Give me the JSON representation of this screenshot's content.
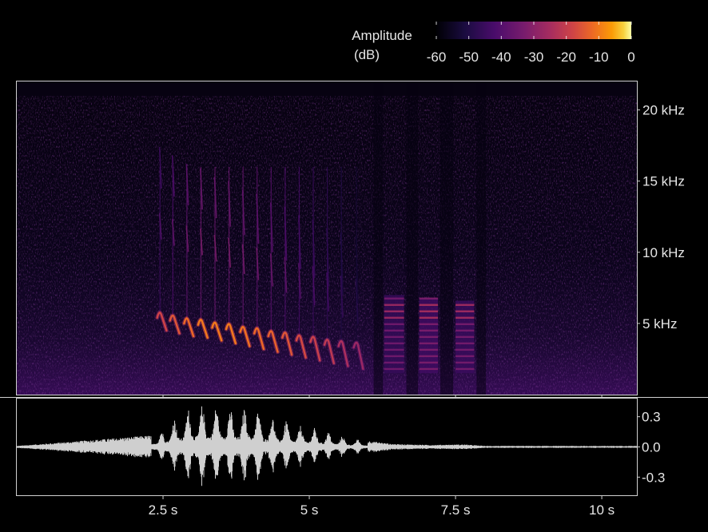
{
  "chart_data": [
    {
      "type": "heatmap",
      "kind": "spectrogram",
      "colormap": "inferno",
      "x_unit": "s",
      "y_unit": "kHz",
      "xlim": [
        0,
        10.6
      ],
      "ylim": [
        0,
        22
      ],
      "ytick_values": [
        5,
        10,
        15,
        20
      ],
      "ytick_labels": [
        "5 kHz",
        "10 kHz",
        "15 kHz",
        "20 kHz"
      ],
      "colorbar": {
        "title_line1": "Amplitude",
        "title_line2": "(dB)",
        "range": [
          -60,
          0
        ],
        "tick_values": [
          -60,
          -50,
          -40,
          -30,
          -20,
          -10,
          0
        ],
        "tick_labels": [
          "-60",
          "-50",
          "-40",
          "-30",
          "-20",
          "-10",
          "0"
        ],
        "position": "top-right"
      },
      "calls": [
        {
          "t": 2.4,
          "f_high": 5.8,
          "f_low": 4.5,
          "level_db": -18
        },
        {
          "t": 2.62,
          "f_high": 5.6,
          "f_low": 4.3,
          "level_db": -15
        },
        {
          "t": 2.86,
          "f_high": 5.4,
          "f_low": 4.1,
          "level_db": -12
        },
        {
          "t": 3.1,
          "f_high": 5.3,
          "f_low": 4.0,
          "level_db": -10
        },
        {
          "t": 3.34,
          "f_high": 5.1,
          "f_low": 3.8,
          "level_db": -10
        },
        {
          "t": 3.58,
          "f_high": 5.0,
          "f_low": 3.6,
          "level_db": -10
        },
        {
          "t": 3.82,
          "f_high": 4.8,
          "f_low": 3.4,
          "level_db": -11
        },
        {
          "t": 4.06,
          "f_high": 4.7,
          "f_low": 3.2,
          "level_db": -12
        },
        {
          "t": 4.3,
          "f_high": 4.5,
          "f_low": 3.0,
          "level_db": -13
        },
        {
          "t": 4.54,
          "f_high": 4.4,
          "f_low": 2.8,
          "level_db": -15
        },
        {
          "t": 4.78,
          "f_high": 4.2,
          "f_low": 2.6,
          "level_db": -17
        },
        {
          "t": 5.02,
          "f_high": 4.1,
          "f_low": 2.4,
          "level_db": -19
        },
        {
          "t": 5.26,
          "f_high": 3.9,
          "f_low": 2.2,
          "level_db": -21
        },
        {
          "t": 5.5,
          "f_high": 3.8,
          "f_low": 2.0,
          "level_db": -24
        },
        {
          "t": 5.76,
          "f_high": 3.7,
          "f_low": 1.8,
          "level_db": -27
        }
      ],
      "buzz_bands": [
        {
          "t_start": 6.28,
          "t_end": 6.62,
          "f_low": 1.5,
          "f_high": 7.0,
          "level_db": -38
        },
        {
          "t_start": 6.88,
          "t_end": 7.2,
          "f_low": 1.5,
          "f_high": 6.8,
          "level_db": -36
        },
        {
          "t_start": 7.5,
          "t_end": 7.82,
          "f_low": 1.5,
          "f_high": 6.6,
          "level_db": -37
        }
      ]
    },
    {
      "type": "line",
      "kind": "waveform",
      "x_unit": "s",
      "xlim": [
        0,
        10.6
      ],
      "ylim": [
        -0.48,
        0.48
      ],
      "ytick_values": [
        0.3,
        0.0,
        -0.3
      ],
      "ytick_labels": [
        "0.3",
        "0.0",
        "-0.3"
      ],
      "xtick_values": [
        2.5,
        5,
        7.5,
        10
      ],
      "xtick_labels": [
        "2.5 s",
        "5 s",
        "7.5 s",
        "10 s"
      ],
      "envelope": {
        "t": [
          0,
          2.4,
          2.62,
          2.86,
          3.1,
          3.34,
          3.58,
          3.82,
          4.06,
          4.3,
          4.54,
          4.78,
          5.02,
          5.26,
          5.5,
          5.76,
          6.4,
          7.05,
          7.65,
          8.0,
          10.6
        ],
        "amplitude": [
          0.01,
          0.12,
          0.25,
          0.36,
          0.42,
          0.41,
          0.4,
          0.38,
          0.4,
          0.3,
          0.28,
          0.22,
          0.2,
          0.16,
          0.12,
          0.08,
          0.03,
          0.02,
          0.025,
          0.01,
          0.01
        ]
      }
    }
  ]
}
